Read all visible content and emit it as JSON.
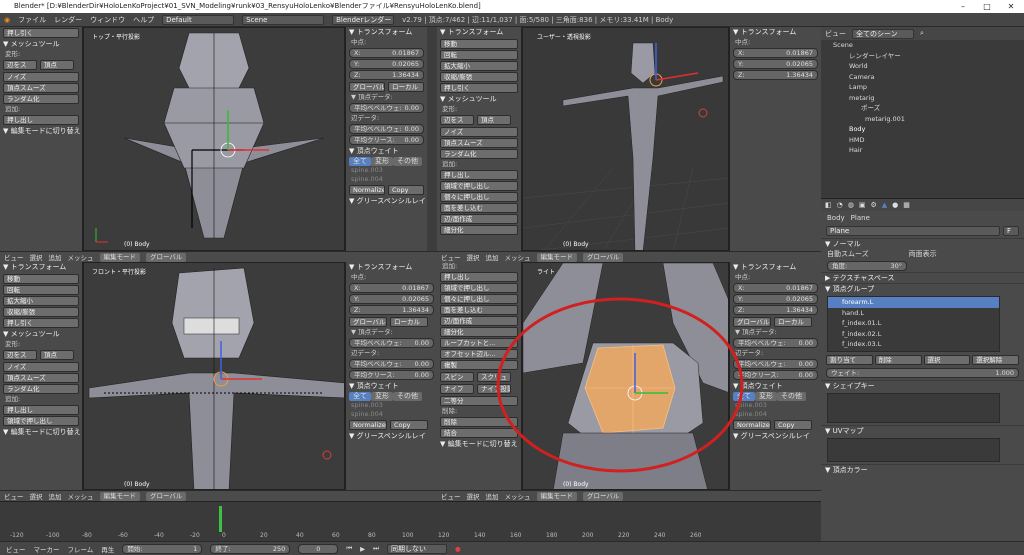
{
  "title": "Blender* [D:¥BlenderDir¥HoloLenKoProject¥01_SVN_Modeling¥runk¥03_RensyuHoloLenko¥Blenderファイル¥RensyuHoloLenKo.blend]",
  "menu": {
    "file": "ファイル",
    "render": "レンダー",
    "window": "ウィンドウ",
    "help": "ヘルプ",
    "layout": "Default",
    "scene": "Scene",
    "engine": "Blenderレンダー",
    "stats": "v2.79 | 頂点:7/462 | 辺:11/1,037 | 面:5/580 | 三角面:836 | メモリ:33.41M | Body"
  },
  "tools": {
    "extrude": "押し出し",
    "mesh_tools": "▼ メッシュツール",
    "deform": "変形:",
    "slide_edge": "辺をス",
    "vert": "頂点",
    "noise": "ノイズ",
    "smooth": "頂点スムーズ",
    "randomize": "ランダム化",
    "add": "追加:",
    "extrude_dd": "押し出し",
    "toggle": "▼ 編集モードに切り替え",
    "move": "移動",
    "rotate": "回転",
    "scale": "拡大縮小",
    "shrink": "収縮/膨張",
    "extrude2": "押し引く",
    "transform": "▼ トランスフォーム",
    "extrude_region": "領域で押し出し",
    "extrude_indiv": "個々に押し出し",
    "inset": "面を差し込む",
    "loopcut": "ループカットと...",
    "offset": "オフセット辺ル...",
    "duplicate": "複製",
    "spin": "スピン",
    "screw": "スクリュ",
    "knife": "ナイフ",
    "knife_proj": "ナイフ投影",
    "bisect": "二等分",
    "remove": "削除:",
    "delete": "削除",
    "merge": "結合",
    "subdivide": "細分化",
    "edge_loop": "辺/面作成"
  },
  "vp": {
    "top": "トップ・平行投影",
    "user": "ユーザー・透視投影",
    "front": "フロント・平行投影",
    "right": "ライト・平行投影",
    "obj": "(0) Body"
  },
  "props": {
    "transform": "▼ トランスフォーム",
    "median": "中点:",
    "x_label": "X:",
    "x": "0.01867",
    "y_label": "Y:",
    "y": "0.02065",
    "z_label": "Z:",
    "z": "1.36434",
    "global": "グローバル",
    "local": "ローカル",
    "vdata": "▼ 頂点データ:",
    "bevel_w": "平均ベベルウェ:",
    "bevel_w_v": "0.00",
    "edata": "辺データ:",
    "bevel_e": "平均ベベルウェ:",
    "bevel_e_v": "0.00",
    "crease": "平均クリース:",
    "crease_v": "0.00",
    "weights": "▼ 頂点ウェイト",
    "all": "全て",
    "deform": "変形",
    "other": "その他",
    "spine003": "spine.003",
    "spine004": "spine.004",
    "zero": "0.",
    "normalize": "Normalize",
    "copy": "Copy",
    "gpencil": "▼ グリースペンシルレイ"
  },
  "vhdr": {
    "view": "ビュー",
    "select": "選択",
    "add": "追加",
    "mesh": "メッシュ",
    "mode": "編集モード",
    "global": "グローバル"
  },
  "outliner": {
    "view": "ビュー",
    "search": "全てのシーン",
    "scene": "Scene",
    "render_layers": "レンダーレイヤー",
    "world": "World",
    "camera": "Camera",
    "lamp": "Lamp",
    "metarig": "metarig",
    "pose": "ポーズ",
    "metarig001": "metarig.001",
    "body": "Body",
    "hmd": "HMD",
    "hair": "Hair"
  },
  "properties": {
    "body": "Body",
    "plane": "Plane",
    "mesh_name": "Plane",
    "f": "F",
    "normals": "▼ ノーマル",
    "auto_smooth": "自動スムーズ",
    "double_sided": "両面表示",
    "angle": "角度:",
    "angle_v": "30°",
    "texspace": "▶ テクスチャスペース",
    "vgroups": "▼ 頂点グループ",
    "vg1": "forearm.L",
    "vg2": "hand.L",
    "vg3": "f_index.01.L",
    "vg4": "f_index.02.L",
    "vg5": "f_index.03.L",
    "assign": "割り当て",
    "remove": "削除",
    "select": "選択",
    "deselect": "選択解除",
    "weight": "ウェイト:",
    "weight_v": "1.000",
    "shapekeys": "▼ シェイプキー",
    "uv": "▼ UVマップ",
    "vcolor": "▼ 頂点カラー"
  },
  "timeline": {
    "ticks": [
      "-20",
      "0",
      "20",
      "40",
      "60",
      "80",
      "100",
      "120",
      "140",
      "160",
      "180",
      "200",
      "220",
      "240",
      "260"
    ],
    "neg": [
      "-120",
      "-100",
      "-80",
      "-60",
      "-40"
    ],
    "view": "ビュー",
    "marker": "マーカー",
    "frame": "フレーム",
    "play": "再生",
    "start": "開始:",
    "start_v": "1",
    "end": "終了:",
    "end_v": "250",
    "current": "0",
    "sync": "同期しない"
  },
  "colors": {
    "accent": "#5680c2",
    "select": "#f0a040",
    "red_circle": "#d02020"
  }
}
